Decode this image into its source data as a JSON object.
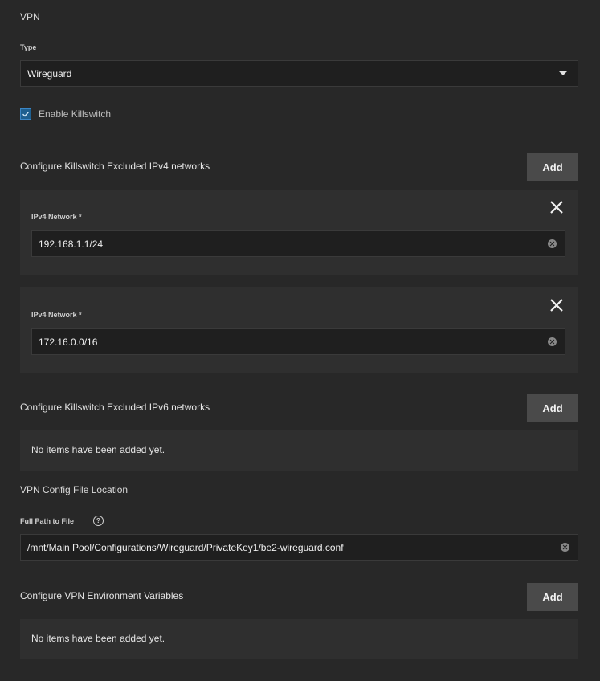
{
  "vpn": {
    "section_title": "VPN",
    "type_label": "Type",
    "type_value": "Wireguard",
    "killswitch_label": "Enable Killswitch",
    "killswitch_checked": true
  },
  "ipv4": {
    "heading": "Configure Killswitch Excluded IPv4 networks",
    "add_label": "Add",
    "items": [
      {
        "label": "IPv4 Network *",
        "value": "192.168.1.1/24"
      },
      {
        "label": "IPv4 Network *",
        "value": "172.16.0.0/16"
      }
    ]
  },
  "ipv6": {
    "heading": "Configure Killswitch Excluded IPv6 networks",
    "add_label": "Add",
    "empty_text": "No items have been added yet."
  },
  "config_file": {
    "section_title": "VPN Config File Location",
    "path_label": "Full Path to File",
    "path_value": "/mnt/Main Pool/Configurations/Wireguard/PrivateKey1/be2-wireguard.conf"
  },
  "env_vars": {
    "heading": "Configure VPN Environment Variables",
    "add_label": "Add",
    "empty_text": "No items have been added yet."
  },
  "colors": {
    "background": "#282828",
    "panel": "#2f2f2f",
    "field": "#1f1f1f",
    "button": "#4a4a4a",
    "checkbox_accent": "#3b86c6"
  }
}
